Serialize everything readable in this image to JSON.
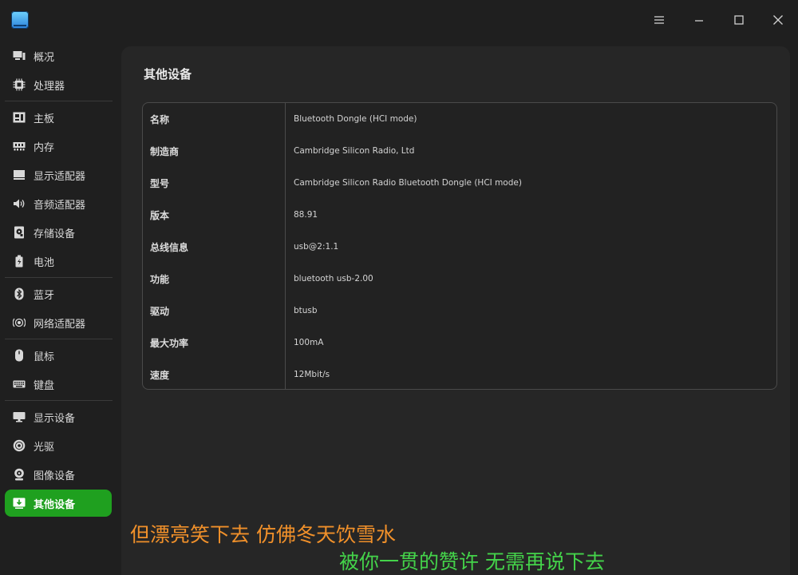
{
  "window": {
    "app_icon": "info-app-icon",
    "controls": [
      "menu-icon",
      "minimize-icon",
      "maximize-icon",
      "close-icon"
    ]
  },
  "sidebar": {
    "items": [
      {
        "label": "概况",
        "icon": "overview-icon"
      },
      {
        "label": "处理器",
        "icon": "cpu-icon"
      },
      {
        "label": "主板",
        "icon": "motherboard-icon"
      },
      {
        "label": "内存",
        "icon": "memory-icon"
      },
      {
        "label": "显示适配器",
        "icon": "display-adapter-icon"
      },
      {
        "label": "音频适配器",
        "icon": "speaker-icon"
      },
      {
        "label": "存储设备",
        "icon": "storage-icon"
      },
      {
        "label": "电池",
        "icon": "battery-icon"
      },
      {
        "label": "蓝牙",
        "icon": "bluetooth-icon"
      },
      {
        "label": "网络适配器",
        "icon": "network-icon"
      },
      {
        "label": "鼠标",
        "icon": "mouse-icon"
      },
      {
        "label": "键盘",
        "icon": "keyboard-icon"
      },
      {
        "label": "显示设备",
        "icon": "monitor-icon"
      },
      {
        "label": "光驱",
        "icon": "disc-icon"
      },
      {
        "label": "图像设备",
        "icon": "camera-icon"
      },
      {
        "label": "其他设备",
        "icon": "other-device-icon"
      }
    ],
    "active_index": 15,
    "active_color": "#1fa01f"
  },
  "main": {
    "title": "其他设备",
    "rows": [
      {
        "key": "名称",
        "value": "Bluetooth Dongle (HCI mode)"
      },
      {
        "key": "制造商",
        "value": "Cambridge Silicon Radio, Ltd"
      },
      {
        "key": "型号",
        "value": "Cambridge Silicon Radio Bluetooth Dongle (HCI mode)"
      },
      {
        "key": "版本",
        "value": "88.91"
      },
      {
        "key": "总线信息",
        "value": "usb@2:1.1"
      },
      {
        "key": "功能",
        "value": "bluetooth usb-2.00"
      },
      {
        "key": "驱动",
        "value": "btusb"
      },
      {
        "key": "最大功率",
        "value": "100mA"
      },
      {
        "key": "速度",
        "value": "12Mbit/s"
      }
    ]
  },
  "overlay": {
    "line1": "但漂亮笑下去  仿佛冬天饮雪水",
    "line2": "被你一贯的赞许  无需再说下去",
    "line1_color": "#f0902a",
    "line2_color": "#44d34a"
  }
}
